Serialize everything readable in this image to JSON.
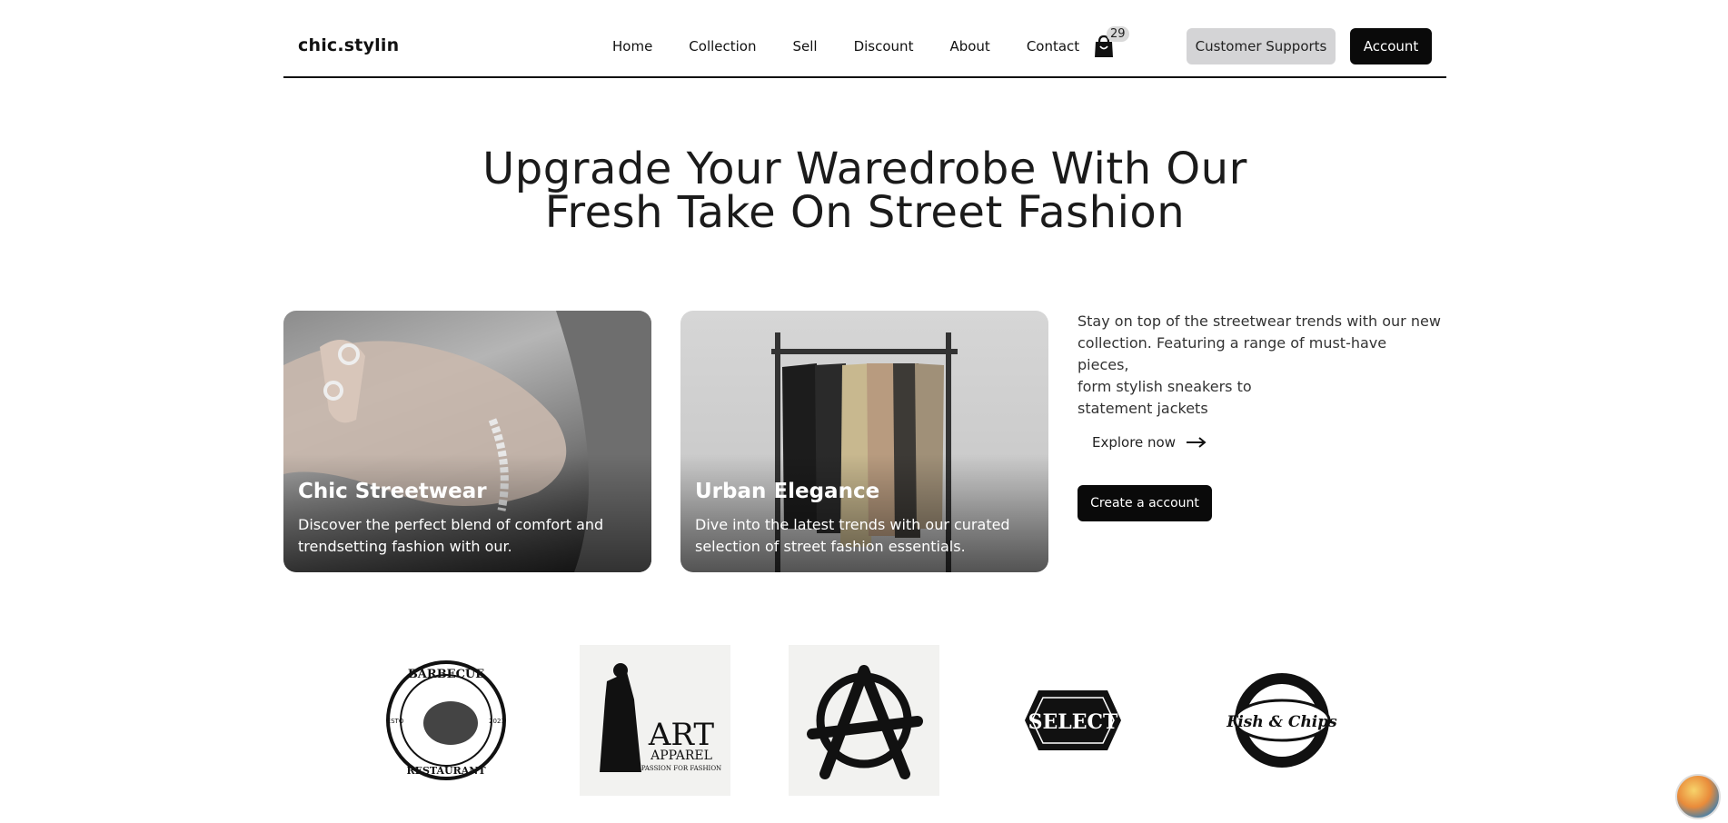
{
  "header": {
    "logo": "chic.stylin",
    "nav": [
      "Home",
      "Collection",
      "Sell",
      "Discount",
      "About",
      "Contact"
    ],
    "cart_count": "29",
    "support_label": "Customer Supports",
    "account_label": "Account"
  },
  "hero": {
    "line1": "Upgrade Your Waredrobe With Our",
    "line2": "Fresh Take On Street Fashion"
  },
  "cards": [
    {
      "title": "Chic Streetwear",
      "desc": "Discover the perfect blend of comfort and trendsetting fashion with our."
    },
    {
      "title": "Urban Elegance",
      "desc": "Dive into the latest trends with our curated selection of street fashion essentials."
    }
  ],
  "side": {
    "line1": "Stay on top of the streetwear trends with our new",
    "line2": "collection. Featuring a range of must-have pieces,",
    "line3": "form stylish sneakers to",
    "line4": "statement jackets",
    "explore_label": "Explore now",
    "create_label": "Create a account"
  },
  "brands": [
    {
      "name": "barbecue-restaurant-logo",
      "top": "BARBECUE",
      "bottom": "RESTAURANT",
      "left": "ESTO",
      "right": "2021"
    },
    {
      "name": "art-apparel-logo",
      "main": "ART",
      "sub": "APPAREL",
      "tag": "PASSION FOR FASHION"
    },
    {
      "name": "anarchy-logo"
    },
    {
      "name": "select-logo",
      "main": "SELECT"
    },
    {
      "name": "fish-chips-logo",
      "main": "Fish & Chips"
    }
  ]
}
